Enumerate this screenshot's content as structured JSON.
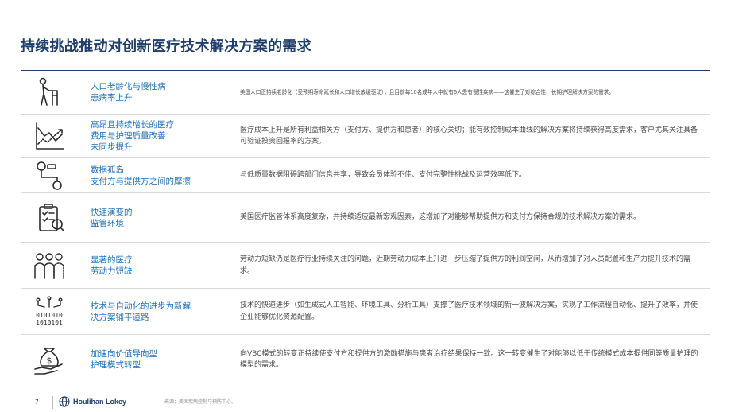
{
  "title": "持续挑战推动对创新医疗技术解决方案的需求",
  "rows": [
    {
      "icon": "elderly-walker-icon",
      "label": [
        "人口老龄化与慢性病",
        "患病率上升"
      ],
      "desc": "美国人口正持续老龄化（受预期寿命延长和人口增长放缓驱动），且目前每10名成年人中就有6人患有慢性疾病——这催生了对综合性、长期护理解决方案的需求。"
    },
    {
      "icon": "rising-cost-chart-icon",
      "label": [
        "高昂且持续增长的医疗",
        "费用与护理质量改善",
        "未同步提升"
      ],
      "desc": "医疗成本上升是所有利益相关方（支付方、提供方和患者）的核心关切；能有效控制成本曲线的解决方案将持续获得高度需求，客户尤其关注具备可验证投资回报率的方案。"
    },
    {
      "icon": "data-silo-icon",
      "label": [
        "数据孤岛",
        "支付方与提供方之间的摩擦"
      ],
      "desc": "与低质量数据阻碍跨部门信息共享，导致会员体验不佳、支付完整性挑战及运营效率低下。"
    },
    {
      "icon": "regulatory-checklist-icon",
      "label": [
        "快速演变的",
        "监管环境"
      ],
      "desc": "美国医疗监管体系高度复杂，并持续适应最新宏观因素，这增加了对能够帮助提供方和支付方保持合规的技术解决方案的需求。"
    },
    {
      "icon": "workforce-people-icon",
      "label": [
        "显著的医疗",
        "劳动力短缺"
      ],
      "desc": "劳动力短缺仍是医疗行业持续关注的问题，近期劳动力成本上升进一步压缩了提供方的利润空间，从而增加了对人员配置和生产力提升技术的需求。"
    },
    {
      "icon": "ai-automation-icon",
      "label": [
        "技术与自动化的进步为新解",
        "决方案铺平道路"
      ],
      "desc": "技术的快速进步（如生成式人工智能、环境工具、分析工具）支撑了医疗技术领域的新一波解决方案，实现了工作流程自动化、提升了效率，并使企业能够优化资源配置。"
    },
    {
      "icon": "value-based-care-icon",
      "label": [
        "加速向价值导向型",
        "护理模式转型"
      ],
      "desc": "向VBC模式的转变正持续使支付方和提供方的激励措施与患者治疗结果保持一致。这一转变催生了对能够以低于传统模式成本提供同等质量护理的模型的需求。"
    }
  ],
  "footer": {
    "page_number": "7",
    "logo_text": "Houlihan Lokey",
    "source": "来源：美国疾病控制与预防中心。"
  },
  "colors": {
    "title": "#1f3f6a",
    "accent": "#1d6fb8",
    "rule": "#d9d9d9"
  }
}
